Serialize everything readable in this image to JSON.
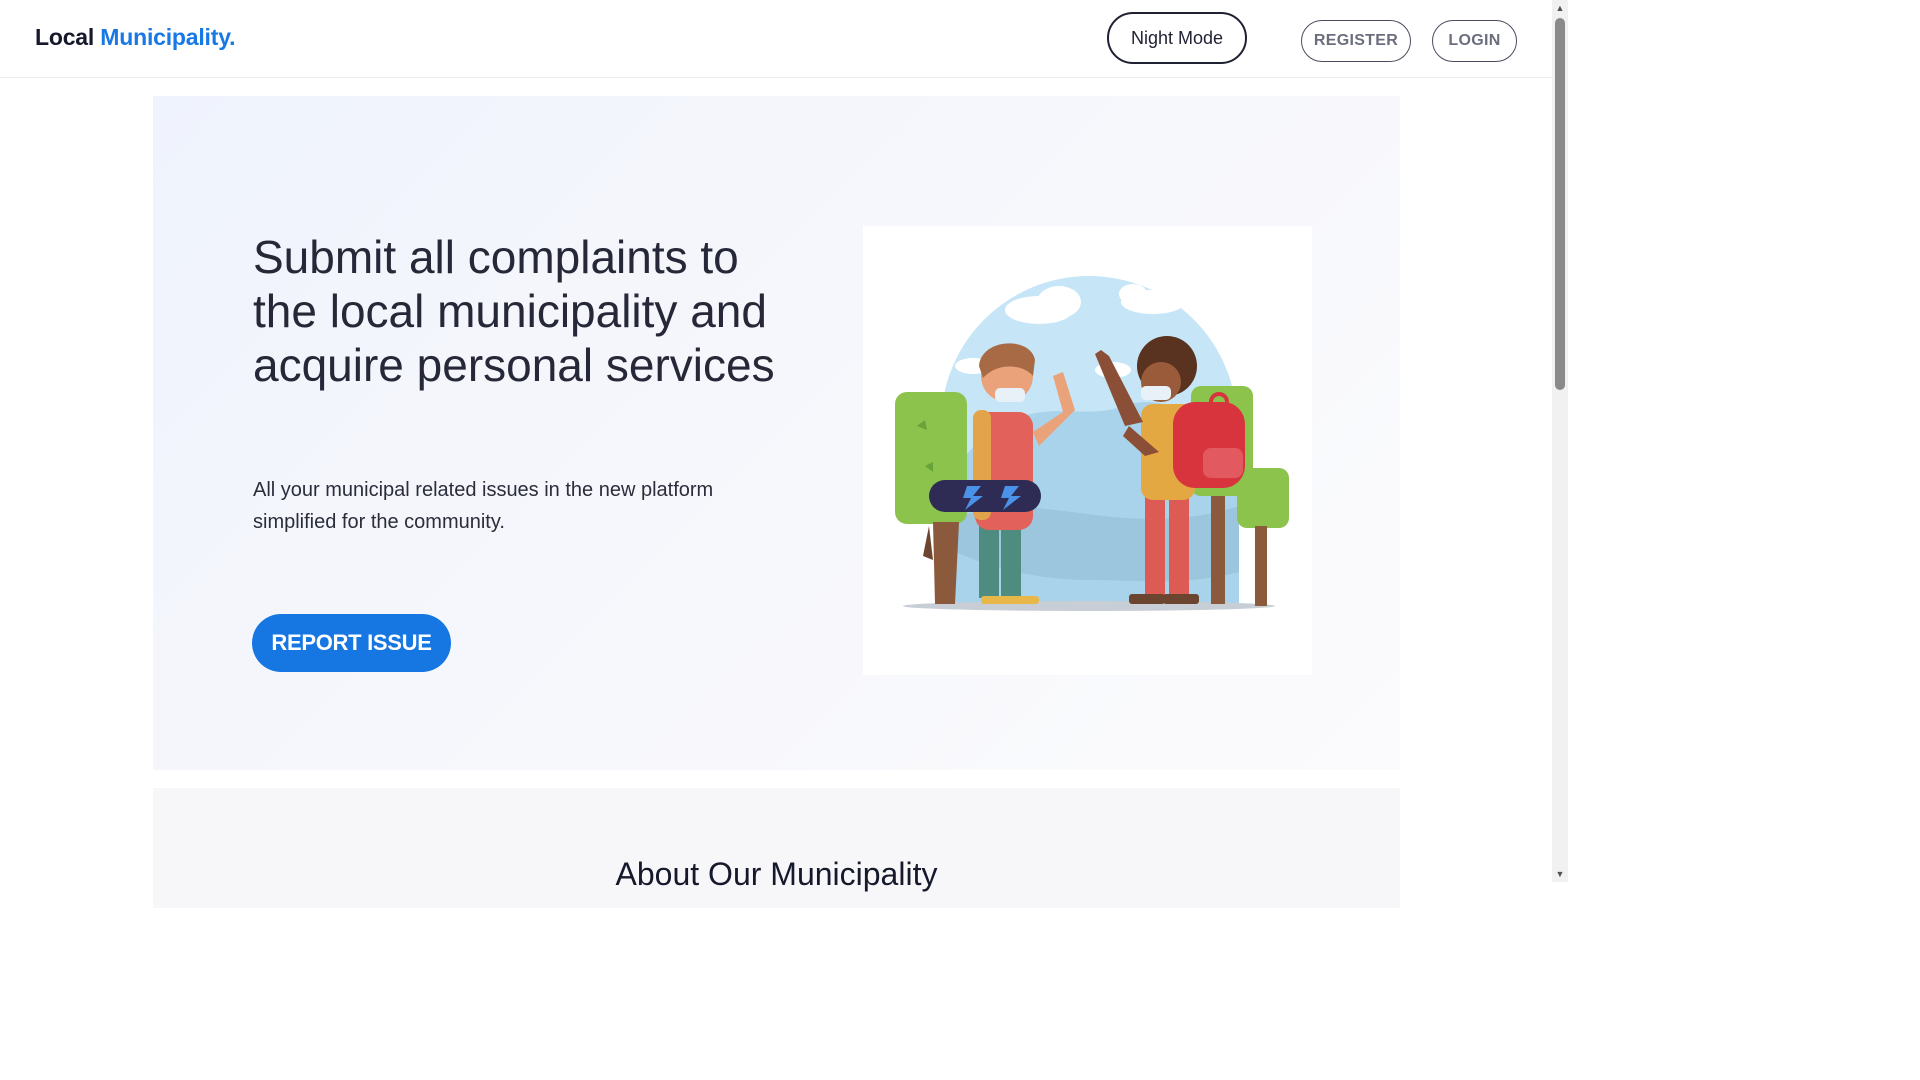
{
  "header": {
    "brand_part1": "Local",
    "brand_part2": "Municipality.",
    "night_mode_label": "Night Mode",
    "register_label": "REGISTER",
    "login_label": "LOGIN"
  },
  "hero": {
    "title": "Submit all complaints to the local municipality and acquire personal services",
    "subtitle": "All your municipal related issues in the new platform simplified for the community.",
    "cta_label": "REPORT ISSUE",
    "illustration_icon": "two-people-waving-illustration"
  },
  "about": {
    "title": "About Our Municipality"
  },
  "colors": {
    "accent": "#1677e2",
    "brand_blue": "#1778e6",
    "text_dark": "#262838"
  }
}
